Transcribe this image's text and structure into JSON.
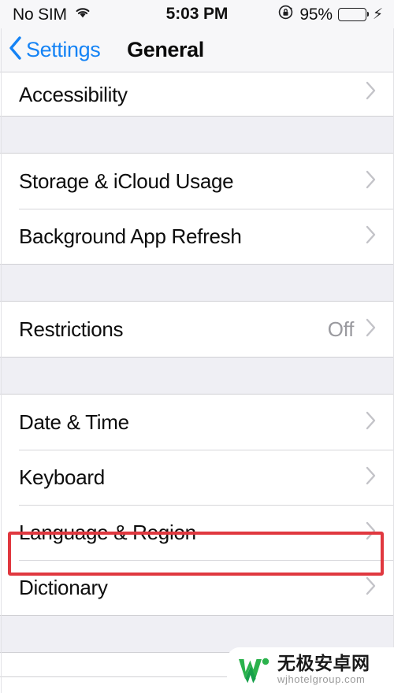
{
  "status_bar": {
    "carrier": "No SIM",
    "wifi_icon": "wifi-icon",
    "time": "5:03 PM",
    "rotation_lock_icon": "rotation-lock-icon",
    "battery_percent": "95%",
    "battery_level": 92,
    "charging_icon": "lightning-bolt-icon",
    "battery_color": "#4cd562"
  },
  "nav_bar": {
    "back_icon": "chevron-left-icon",
    "back_label": "Settings",
    "title": "General",
    "tint_color": "#1583f5"
  },
  "groups": [
    {
      "id": "group-accessibility",
      "rows": [
        {
          "label": "Accessibility",
          "value": "",
          "accessory": "chevron-right-icon",
          "clipped": true,
          "highlighted": false
        }
      ]
    },
    {
      "id": "group-storage",
      "rows": [
        {
          "label": "Storage & iCloud Usage",
          "value": "",
          "accessory": "chevron-right-icon",
          "clipped": false,
          "highlighted": false
        },
        {
          "label": "Background App Refresh",
          "value": "",
          "accessory": "chevron-right-icon",
          "clipped": false,
          "highlighted": false
        }
      ]
    },
    {
      "id": "group-restrictions",
      "rows": [
        {
          "label": "Restrictions",
          "value": "Off",
          "accessory": "chevron-right-icon",
          "clipped": false,
          "highlighted": false
        }
      ]
    },
    {
      "id": "group-datetime",
      "rows": [
        {
          "label": "Date & Time",
          "value": "",
          "accessory": "chevron-right-icon",
          "clipped": false,
          "highlighted": false
        },
        {
          "label": "Keyboard",
          "value": "",
          "accessory": "chevron-right-icon",
          "clipped": false,
          "highlighted": false
        },
        {
          "label": "Language & Region",
          "value": "",
          "accessory": "chevron-right-icon",
          "clipped": false,
          "highlighted": true
        },
        {
          "label": "Dictionary",
          "value": "",
          "accessory": "chevron-right-icon",
          "clipped": false,
          "highlighted": false
        }
      ]
    }
  ],
  "annotation": {
    "type": "highlight-rectangle",
    "target_label": "Language & Region",
    "color": "#e0383f"
  },
  "watermark": {
    "logo_icon": "w-logo-icon",
    "logo_color": "#1eab4b",
    "name": "无极安卓网",
    "url": "wjhotelgroup.com"
  }
}
